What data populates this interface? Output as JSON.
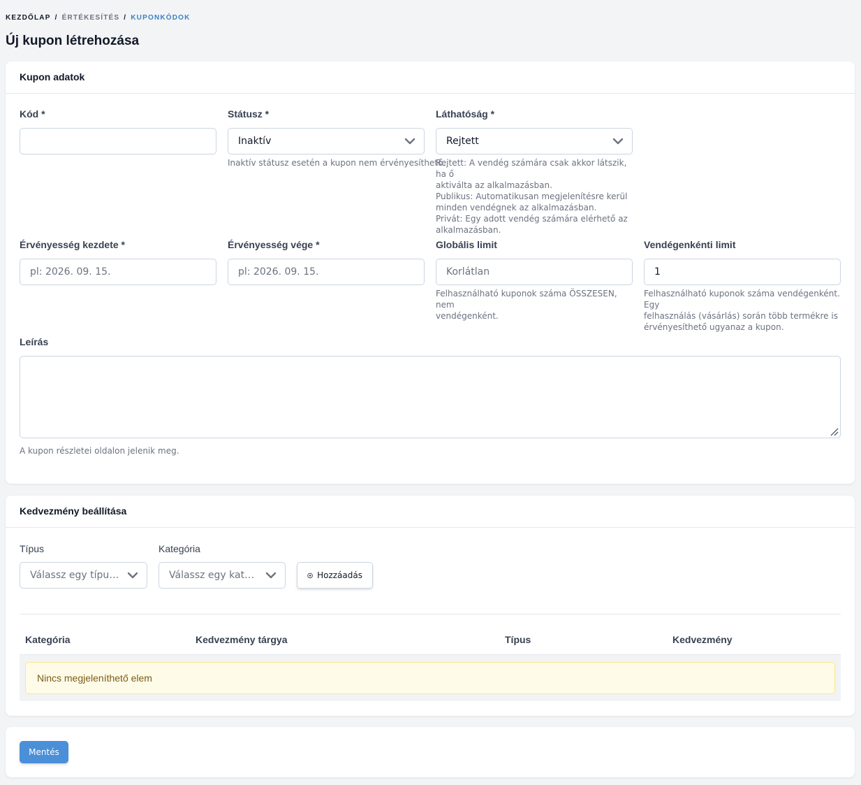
{
  "breadcrumb": {
    "home": "KEZDŐLAP",
    "section": "ÉRTÉKESÍTÉS",
    "current": "KUPONKÓDOK",
    "separator": "/"
  },
  "page_title": "Új kupon létrehozása",
  "coupon_card": {
    "title": "Kupon adatok",
    "code": {
      "label": "Kód *",
      "value": ""
    },
    "status": {
      "label": "Státusz *",
      "value": "Inaktív",
      "help": "Inaktív státusz esetén a kupon nem érvényesíthető."
    },
    "visibility": {
      "label": "Láthatóság *",
      "value": "Rejtett",
      "help": [
        "Rejtett: A vendég számára csak akkor látszik, ha ő",
        "aktiválta az alkalmazásban.",
        "Publikus: Automatikusan megjelenítésre kerül",
        "minden vendégnek az alkalmazásban.",
        "Privát: Egy adott vendég számára elérhető az",
        "alkalmazásban."
      ]
    },
    "valid_from": {
      "label": "Érvényesség kezdete *",
      "placeholder": "pl: 2026. 09. 15."
    },
    "valid_to": {
      "label": "Érvényesség vége *",
      "placeholder": "pl: 2026. 09. 15."
    },
    "global_limit": {
      "label": "Globális limit",
      "placeholder": "Korlátlan",
      "help": [
        "Felhasználható kuponok száma ÖSSZESEN, nem",
        "vendégenként."
      ]
    },
    "per_guest_limit": {
      "label": "Vendégenkénti limit",
      "value": "1",
      "help": [
        "Felhasználható kuponok száma vendégenként. Egy",
        "felhasználás (vásárlás) során több termékre is",
        "érvényesíthető ugyanaz a kupon."
      ]
    },
    "description": {
      "label": "Leírás",
      "value": "",
      "help": "A kupon részletei oldalon jelenik meg."
    }
  },
  "discount_card": {
    "title": "Kedvezmény beállítása",
    "type": {
      "label": "Típus",
      "placeholder": "Válassz egy típust!"
    },
    "category": {
      "label": "Kategória",
      "placeholder": "Válassz egy kategór..."
    },
    "add_button": "Hozzáadás",
    "table": {
      "headers": [
        "Kategória",
        "Kedvezmény tárgya",
        "Típus",
        "Kedvezmény"
      ],
      "empty_text": "Nincs megjeleníthető elem"
    }
  },
  "save_button": "Mentés",
  "colors": {
    "accent": "#4a8fd8",
    "breadcrumb_current": "#3b82c4",
    "empty_bg": "#fefce8"
  },
  "icons": [
    "chevron-down-icon",
    "plus-circle-icon",
    "resize-handle-icon"
  ]
}
